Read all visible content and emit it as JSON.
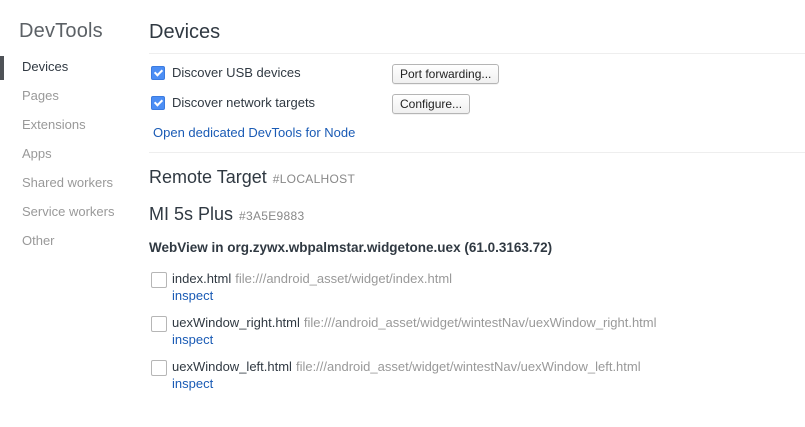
{
  "sidebar": {
    "title": "DevTools",
    "items": [
      {
        "label": "Devices",
        "active": true
      },
      {
        "label": "Pages"
      },
      {
        "label": "Extensions"
      },
      {
        "label": "Apps"
      },
      {
        "label": "Shared workers"
      },
      {
        "label": "Service workers"
      },
      {
        "label": "Other"
      }
    ]
  },
  "main": {
    "title": "Devices",
    "options": [
      {
        "label": "Discover USB devices",
        "checked": true,
        "button": "Port forwarding..."
      },
      {
        "label": "Discover network targets",
        "checked": true,
        "button": "Configure..."
      }
    ],
    "node_link": "Open dedicated DevTools for Node",
    "remote": {
      "title": "Remote Target",
      "tag": "#LOCALHOST"
    },
    "device": {
      "name": "MI 5s Plus",
      "id": "#3A5E9883"
    },
    "webview": "WebView in org.zywx.wbpalmstar.widgetone.uex (61.0.3163.72)",
    "targets": [
      {
        "name": "index.html",
        "url": "file:///android_asset/widget/index.html",
        "action": "inspect"
      },
      {
        "name": "uexWindow_right.html",
        "url": "file:///android_asset/widget/wintestNav/uexWindow_right.html",
        "action": "inspect"
      },
      {
        "name": "uexWindow_left.html",
        "url": "file:///android_asset/widget/wintestNav/uexWindow_left.html",
        "action": "inspect"
      }
    ]
  },
  "colors": {
    "accent_checkbox": "#4c8ef5",
    "link": "#1a5bb5",
    "muted_text": "#999999"
  }
}
